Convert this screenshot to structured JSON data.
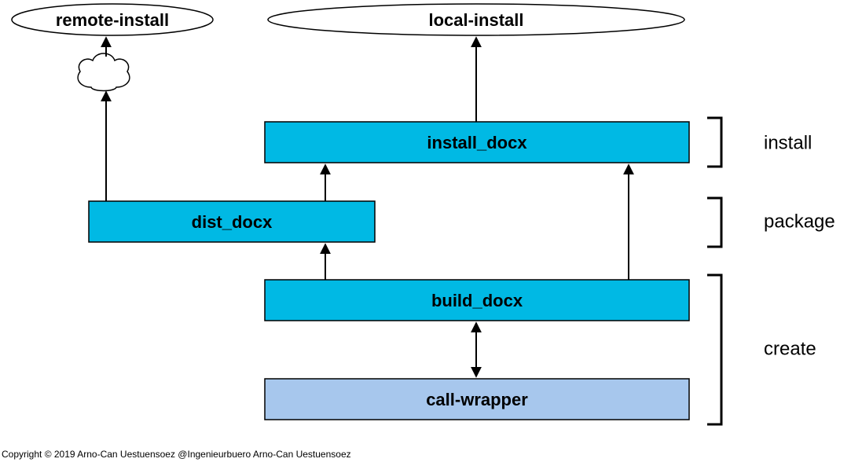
{
  "nodes": {
    "remote_install": "remote-install",
    "local_install": "local-install",
    "install_docx": "install_docx",
    "dist_docx": "dist_docx",
    "build_docx": "build_docx",
    "call_wrapper": "call-wrapper"
  },
  "stages": {
    "install": "install",
    "package": "package",
    "create": "create"
  },
  "footer": "Copyright © 2019 Arno-Can Uestuensoez @Ingenieurbuero Arno-Can Uestuensoez",
  "colors": {
    "cyan": "#00b9e4",
    "lightblue": "#a7c7ed",
    "stroke": "#000000"
  }
}
